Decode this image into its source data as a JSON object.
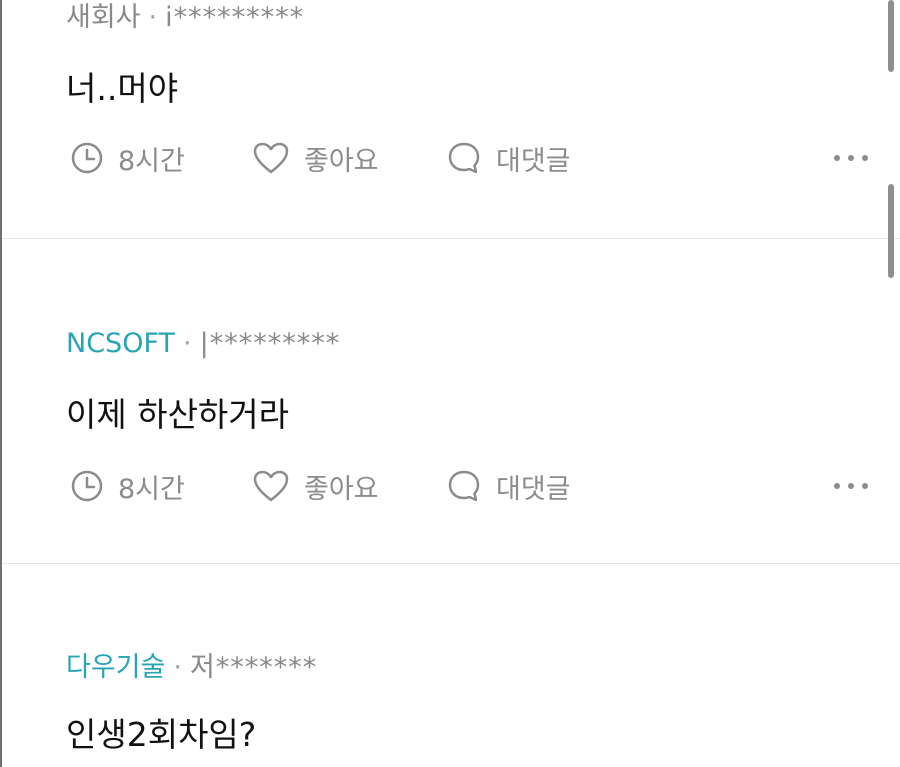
{
  "comments": [
    {
      "company": "새회사",
      "separator": "·",
      "author": "i*********",
      "text": "너..머야",
      "time_label": "8시간",
      "like_label": "좋아요",
      "reply_label": "대댓글"
    },
    {
      "company": "NCSOFT",
      "separator": "·",
      "author": "|*********",
      "text": "이제 하산하거라",
      "time_label": "8시간",
      "like_label": "좋아요",
      "reply_label": "대댓글"
    },
    {
      "company": "다우기술",
      "separator": "·",
      "author": "저*******",
      "text": "인생2회차임?"
    }
  ],
  "icons": {
    "time": "clock-icon",
    "like": "heart-icon",
    "reply": "speech-bubble-icon",
    "more": "more-dots-icon"
  },
  "colors": {
    "company_link": "#28a4b5",
    "meta_gray": "#8a8a8a",
    "body_text": "#111111",
    "divider": "#e6e6e6"
  }
}
